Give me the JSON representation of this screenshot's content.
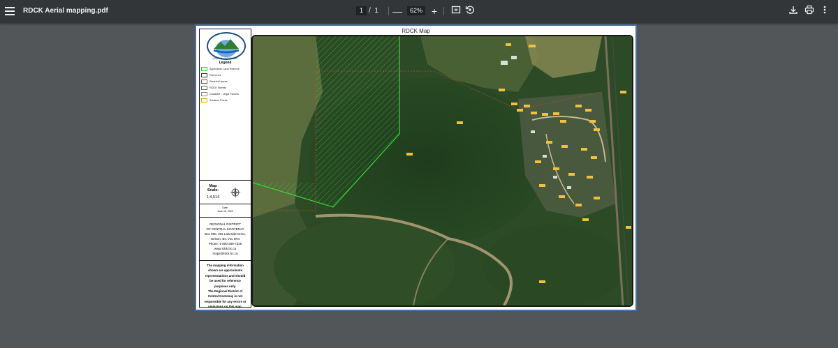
{
  "toolbar": {
    "file_name": "RDCK Aerial mapping.pdf",
    "current_page": "1",
    "page_separator": "/",
    "total_pages": "1",
    "zoom_out_label": "—",
    "zoom_level": "62%",
    "zoom_in_label": "+",
    "icons": {
      "menu": "menu-icon",
      "fit": "fit-page-icon",
      "rotate": "rotate-icon",
      "download": "download-icon",
      "print": "print-icon",
      "more": "more-vert-icon"
    }
  },
  "document": {
    "map_title": "RDCK Map",
    "logo_text": "CENTRAL KOOTENAY",
    "legend": {
      "title": "Legend",
      "items": [
        {
          "label": "Agriculture Land Reserve",
          "color": "#33cc33"
        },
        {
          "label": "Rail Lines",
          "color": "#333333"
        },
        {
          "label": "Electoral Areas",
          "color": "#cc3333"
        },
        {
          "label": "RDCK Streets",
          "color": "#666666"
        },
        {
          "label": "Cadastre - Legal Parcels",
          "color": "#888888"
        },
        {
          "label": "Address Points",
          "color": "#e8a000"
        }
      ]
    },
    "scale": {
      "label_line1": "Map",
      "label_line2": "Scale:",
      "value": "1:4,514"
    },
    "date": {
      "label": "Date:",
      "value": "June 16, 2023"
    },
    "address": {
      "line1": "REGIONAL DISTRICT",
      "line2": "OF CENTRAL KOOTENAY",
      "line3": "Box 590, 202 Lakeside Drive,",
      "line4": "Nelson, BC V1L 5R4",
      "line5": "Phone: 1-800-268-7325",
      "line6": "www.rdck.bc.ca",
      "line7": "maps@rdck.bc.ca"
    },
    "disclaimer": {
      "line1": "The mapping information",
      "line2": "shown are approximate",
      "line3": "representations and should",
      "line4": "be used for reference",
      "line5": "purposes only.",
      "line6": "The Regional District of",
      "line7": "Central Kootenay is not",
      "line8": "responsible for any errors or",
      "line9": "omissions on this map."
    }
  }
}
